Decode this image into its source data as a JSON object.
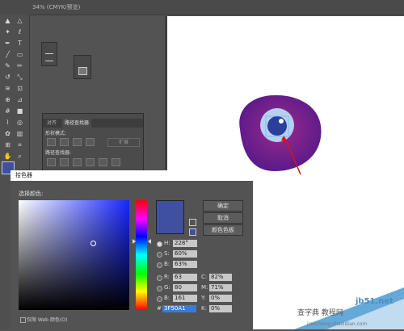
{
  "window": {
    "doc_tab": "34% (CMYK/预览)"
  },
  "pathfinder": {
    "tab_align": "对齐",
    "tab_pathfinder": "路径查找器",
    "shape_modes": "形状模式:",
    "expand": "扩展",
    "pathfinders": "路径查找器:"
  },
  "picker": {
    "title": "拾色器",
    "select_color": "选择颜色:",
    "ok": "确定",
    "cancel": "取消",
    "swatches": "颜色色板",
    "web_only": "仅限 Web 颜色(O)",
    "fields": {
      "H": {
        "label": "H:",
        "value": "228°"
      },
      "S": {
        "label": "S:",
        "value": "60%"
      },
      "B": {
        "label": "B:",
        "value": "63%"
      },
      "R": {
        "label": "R:",
        "value": "63"
      },
      "G": {
        "label": "G:",
        "value": "80"
      },
      "Bl": {
        "label": "B:",
        "value": "161"
      },
      "C": {
        "label": "C:",
        "value": "82%"
      },
      "M": {
        "label": "M:",
        "value": "71%"
      },
      "Y": {
        "label": "Y:",
        "value": "0%"
      },
      "K": {
        "label": "K:",
        "value": "0%"
      },
      "hex": {
        "label": "#",
        "value": "3F50A1"
      }
    },
    "new_color": "#3f50a1"
  },
  "watermark": {
    "text": "查字典 教程网",
    "site": "jb51.net",
    "url": "jiaocheng.chazidian.com"
  },
  "colors": {
    "accent_purple": "#6b1f8c",
    "selection_blue": "#3f50a1"
  },
  "icons": [
    "selection-tool-icon",
    "direct-selection-icon",
    "magic-wand-icon",
    "lasso-icon",
    "pen-icon",
    "type-icon",
    "line-icon",
    "rectangle-icon",
    "brush-icon",
    "pencil-icon",
    "rotate-icon",
    "scale-icon",
    "width-icon",
    "free-transform-icon",
    "shape-builder-icon",
    "perspective-icon",
    "mesh-icon",
    "gradient-icon",
    "eyedropper-icon",
    "blend-icon",
    "symbol-icon",
    "graph-icon",
    "artboard-icon",
    "slice-icon",
    "hand-icon",
    "zoom-icon"
  ]
}
